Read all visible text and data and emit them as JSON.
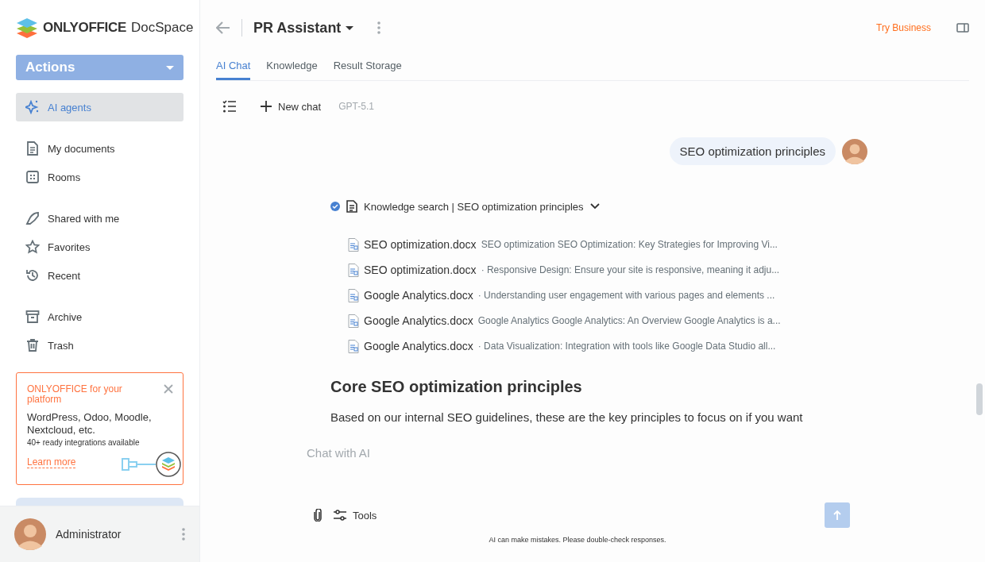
{
  "logo": {
    "brand": "ONLYOFFICE",
    "product": "DocSpace"
  },
  "actions_button": {
    "label": "Actions"
  },
  "sidebar": {
    "groups": [
      {
        "items": [
          {
            "kind": "agents",
            "label": "AI agents",
            "selected": true
          }
        ]
      },
      {
        "items": [
          {
            "kind": "documents",
            "label": "My documents",
            "selected": false
          },
          {
            "kind": "rooms",
            "label": "Rooms",
            "selected": false
          }
        ]
      },
      {
        "items": [
          {
            "kind": "shared",
            "label": "Shared with me",
            "selected": false
          },
          {
            "kind": "favorites",
            "label": "Favorites",
            "selected": false
          },
          {
            "kind": "recent",
            "label": "Recent",
            "selected": false
          }
        ]
      },
      {
        "items": [
          {
            "kind": "archive",
            "label": "Archive",
            "selected": false
          },
          {
            "kind": "trash",
            "label": "Trash",
            "selected": false
          }
        ]
      }
    ]
  },
  "promo": {
    "title": "ONLYOFFICE for your platform",
    "headline": "WordPress, Odoo, Moodle, Nextcloud, etc.",
    "subtitle": "40+ ready integrations available",
    "link": "Learn more"
  },
  "user": {
    "name": "Administrator"
  },
  "header": {
    "title": "PR Assistant",
    "try_business": "Try Business"
  },
  "tabs": [
    {
      "label": "AI Chat",
      "selected": true
    },
    {
      "label": "Knowledge",
      "selected": false
    },
    {
      "label": "Result Storage",
      "selected": false
    }
  ],
  "toolbar": {
    "new_chat": "New chat",
    "model": "GPT-5.1"
  },
  "chat": {
    "user_message": "SEO optimization principles",
    "tool_call": {
      "label": "Knowledge search | SEO optimization principles",
      "done": true
    },
    "results": [
      {
        "file": "SEO optimization.docx",
        "snippet": "SEO optimization SEO Optimization: Key Strategies for Improving Vi..."
      },
      {
        "file": "SEO optimization.docx",
        "snippet": "· Responsive Design: Ensure your site is responsive, meaning it adju..."
      },
      {
        "file": "Google Analytics.docx",
        "snippet": "· Understanding user engagement with various pages and elements ..."
      },
      {
        "file": "Google Analytics.docx",
        "snippet": "Google Analytics Google Analytics: An Overview Google Analytics is a..."
      },
      {
        "file": "Google Analytics.docx",
        "snippet": "· Data Visualization: Integration with tools like Google Data Studio all..."
      }
    ],
    "heading": "Core SEO optimization principles",
    "paragraph": "Based on our internal SEO guidelines, these are the key principles to focus on if you want"
  },
  "composer": {
    "placeholder": "Chat with AI",
    "tools": "Tools",
    "disclaimer": "AI can make mistakes. Please double-check responses."
  }
}
